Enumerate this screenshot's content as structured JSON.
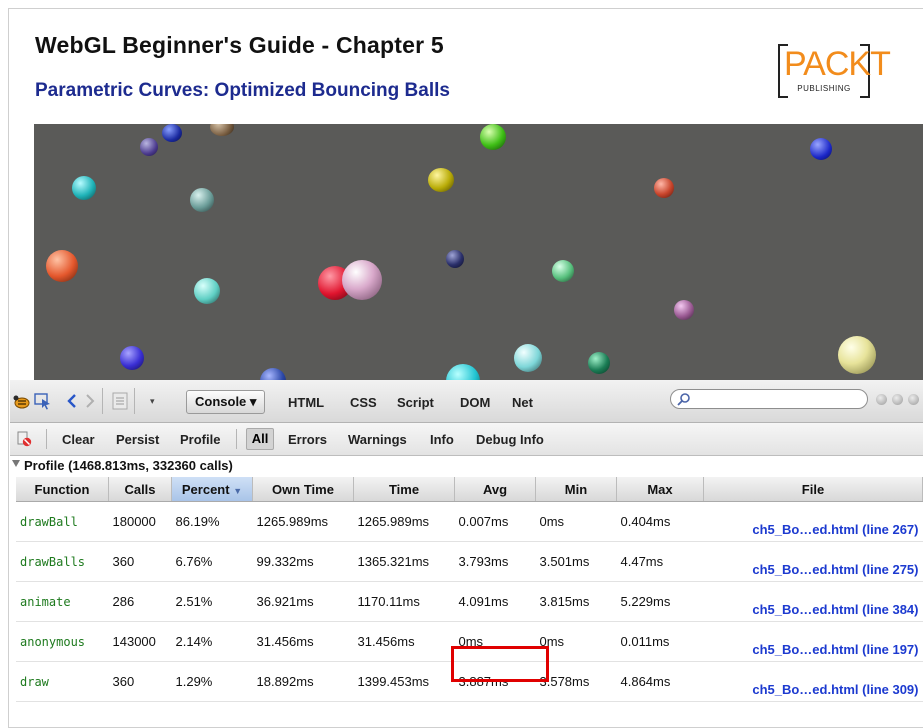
{
  "page": {
    "title": "WebGL Beginner's Guide - Chapter 5",
    "subtitle": "Parametric Curves: Optimized Bouncing Balls"
  },
  "logo": {
    "brand": "PACKT",
    "tagline": "PUBLISHING",
    "color": "#f28c1c"
  },
  "canvas": {
    "background": "#5a5a58"
  },
  "firebug": {
    "tabs": [
      "Console",
      "HTML",
      "CSS",
      "Script",
      "DOM",
      "Net"
    ],
    "console_filters": [
      "Clear",
      "Persist",
      "Profile",
      "All",
      "Errors",
      "Warnings",
      "Info",
      "Debug Info"
    ],
    "profile_header": "Profile (1468.813ms, 332360 calls)",
    "columns": [
      "Function",
      "Calls",
      "Percent",
      "Own Time",
      "Time",
      "Avg",
      "Min",
      "Max",
      "File"
    ],
    "rows": [
      [
        "drawBall",
        "180000",
        "86.19%",
        "1265.989ms",
        "1265.989ms",
        "0.007ms",
        "0ms",
        "0.404ms",
        "ch5_Bo…ed.html (line 267)"
      ],
      [
        "drawBalls",
        "360",
        "6.76%",
        "99.332ms",
        "1365.321ms",
        "3.793ms",
        "3.501ms",
        "4.47ms",
        "ch5_Bo…ed.html (line 275)"
      ],
      [
        "animate",
        "286",
        "2.51%",
        "36.921ms",
        "1170.11ms",
        "4.091ms",
        "3.815ms",
        "5.229ms",
        "ch5_Bo…ed.html (line 384)"
      ],
      [
        "anonymous",
        "143000",
        "2.14%",
        "31.456ms",
        "31.456ms",
        "0ms",
        "0ms",
        "0.011ms",
        "ch5_Bo…ed.html (line 197)"
      ],
      [
        "draw",
        "360",
        "1.29%",
        "18.892ms",
        "1399.453ms",
        "3.887ms",
        "3.578ms",
        "4.864ms",
        "ch5_Bo…ed.html (line 309)"
      ]
    ],
    "highlight_color": "#e00000"
  }
}
